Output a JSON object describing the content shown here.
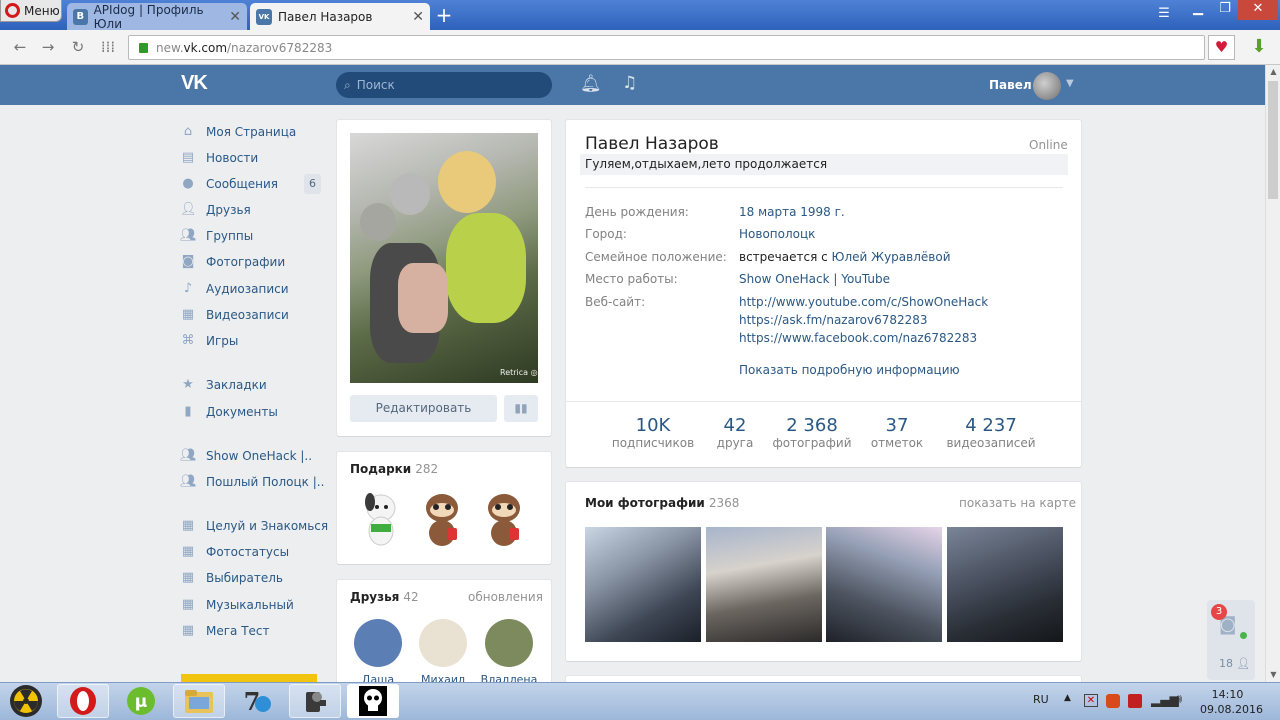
{
  "browser": {
    "menu_label": "Меню",
    "tabs": [
      {
        "title": "APIdog | Профиль Юли",
        "favicon": "В"
      },
      {
        "title": "Павел Назаров",
        "favicon": "VK"
      }
    ],
    "url_prefix": "new.",
    "url_domain": "vk.com",
    "url_path": "/nazarov6782283"
  },
  "vk": {
    "logo": "VK",
    "search_placeholder": "Поиск",
    "header_user": "Павел"
  },
  "menu": {
    "items": [
      {
        "label": "Моя Страница",
        "icon": "home-icon"
      },
      {
        "label": "Новости",
        "icon": "news-icon"
      },
      {
        "label": "Сообщения",
        "icon": "messages-icon",
        "badge": "6"
      },
      {
        "label": "Друзья",
        "icon": "friends-icon"
      },
      {
        "label": "Группы",
        "icon": "groups-icon"
      },
      {
        "label": "Фотографии",
        "icon": "camera-icon"
      },
      {
        "label": "Аудиозаписи",
        "icon": "music-icon"
      },
      {
        "label": "Видеозаписи",
        "icon": "video-icon"
      },
      {
        "label": "Игры",
        "icon": "gamepad-icon"
      }
    ],
    "extra": [
      {
        "label": "Закладки",
        "icon": "star-icon"
      },
      {
        "label": "Документы",
        "icon": "document-icon"
      }
    ],
    "groups": [
      {
        "label": "Show OneHack |..",
        "icon": "group-icon"
      },
      {
        "label": "Пошлый Полоцк |..",
        "icon": "group-icon"
      }
    ],
    "apps": [
      {
        "label": "Целуй и Знакомься",
        "icon": "app-icon"
      },
      {
        "label": "Фотостатусы",
        "icon": "app-icon"
      },
      {
        "label": "Выбиратель",
        "icon": "app-icon"
      },
      {
        "label": "Музыкальный",
        "icon": "app-icon"
      },
      {
        "label": "Мега Тест",
        "icon": "app-icon"
      }
    ]
  },
  "profile": {
    "edit_label": "Редактировать",
    "photo_watermark": "Retrica ◎",
    "name": "Павел Назаров",
    "online": "Online",
    "status": "Гуляем,отдыхаем,лето продолжается",
    "info": [
      {
        "label": "День рождения:",
        "value": "18 марта 1998 г."
      },
      {
        "label": "Город:",
        "value": "Новополоцк"
      },
      {
        "label": "Семейное положение:",
        "value_prefix": "встречается с ",
        "value": "Юлей Журавлёвой"
      },
      {
        "label": "Место работы:",
        "value": "Show OneHack | YouTube"
      },
      {
        "label": "Веб-сайт:",
        "value": "http://www.youtube.com/c/ShowOneHack"
      }
    ],
    "websites_extra": [
      "https://ask.fm/nazarov6782283",
      "https://www.facebook.com/naz6782283"
    ],
    "show_more": "Показать подробную информацию",
    "counters": [
      {
        "value": "10K",
        "label": "подписчиков"
      },
      {
        "value": "42",
        "label": "друга"
      },
      {
        "value": "2 368",
        "label": "фотографий"
      },
      {
        "value": "37",
        "label": "отметок"
      },
      {
        "value": "4 237",
        "label": "видеозаписей"
      }
    ]
  },
  "gifts": {
    "title": "Подарки",
    "count": "282"
  },
  "friends": {
    "title": "Друзья",
    "count": "42",
    "updates": "обновления",
    "items": [
      {
        "name": "Даша",
        "color": "#5b7fb5"
      },
      {
        "name": "Михаил",
        "color": "#e9e2d2"
      },
      {
        "name": "Владлена",
        "color": "#7d8a5e"
      }
    ]
  },
  "photos": {
    "title": "Мои фотографии",
    "count": "2368",
    "map_link": "показать на карте"
  },
  "widget": {
    "badge": "3",
    "count": "18"
  },
  "taskbar": {
    "lang": "RU",
    "time": "14:10",
    "date": "09.08.2016"
  }
}
